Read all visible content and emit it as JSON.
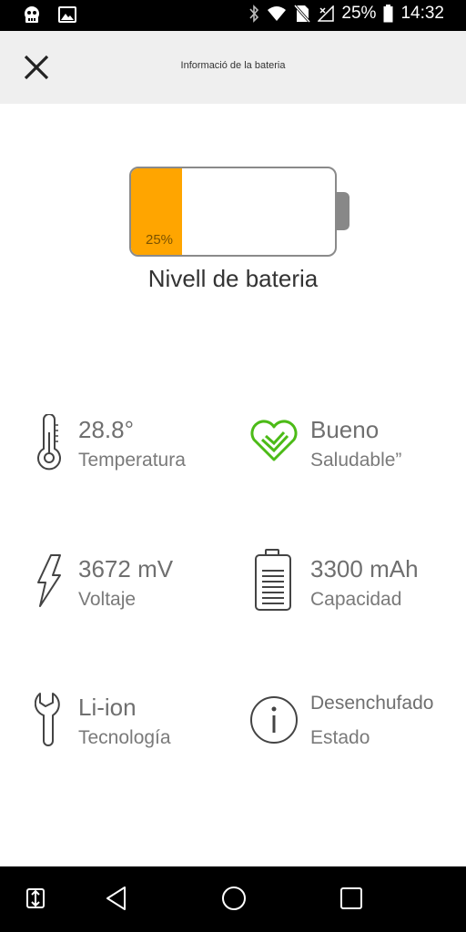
{
  "status_bar": {
    "battery_percent": "25%",
    "time": "14:32"
  },
  "toolbar": {
    "title": "Informació de la bateria"
  },
  "battery": {
    "level_label": "25%",
    "level_fraction": 0.25,
    "fill_color": "#ffa500",
    "caption": "Nivell de bateria"
  },
  "info": {
    "temperature": {
      "value": "28.8°",
      "label": "Temperatura"
    },
    "health": {
      "value": "Bueno",
      "label": "Saludable”",
      "icon_color": "#4cbb17"
    },
    "voltage": {
      "value": "3672 mV",
      "label": "Voltaje"
    },
    "capacity": {
      "value": "3300 mAh",
      "label": "Capacidad"
    },
    "technology": {
      "value": "Li-ion",
      "label": "Tecnología"
    },
    "status": {
      "value": "Desenchufado",
      "label": "Estado"
    }
  }
}
